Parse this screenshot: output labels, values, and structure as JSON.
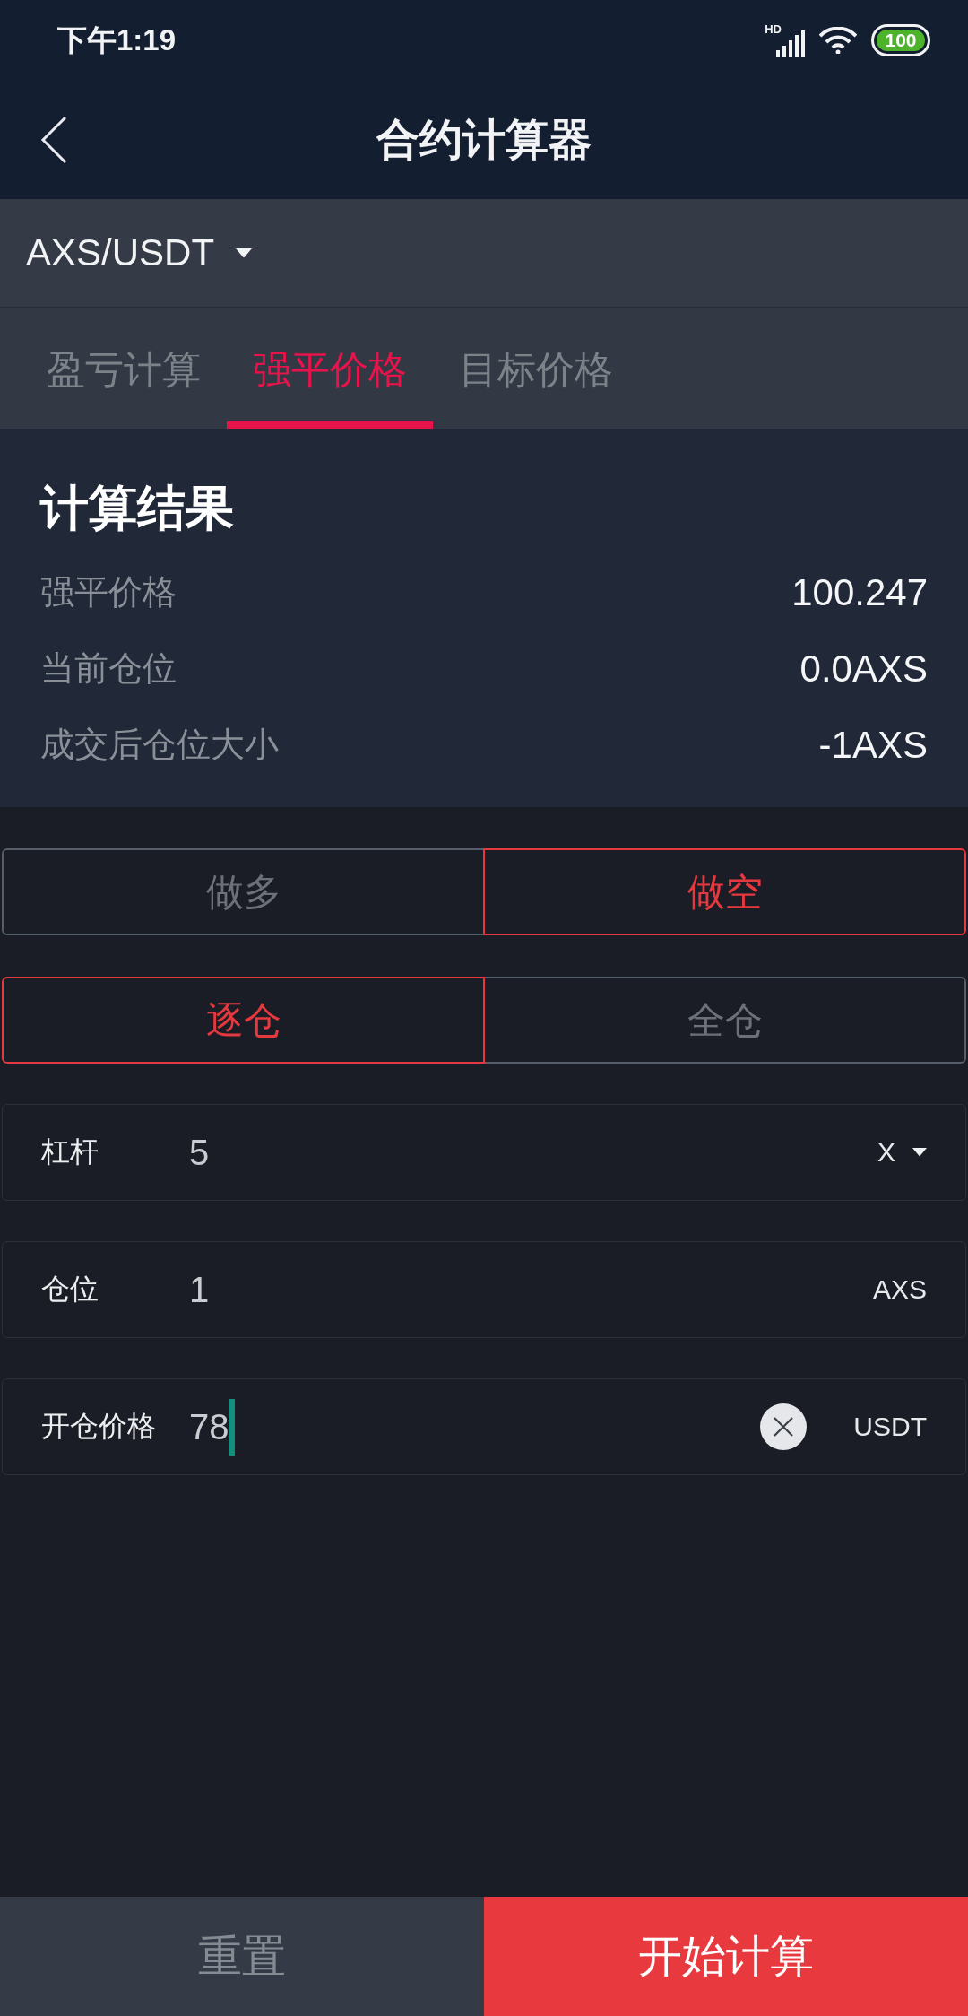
{
  "status_bar": {
    "time": "下午1:19",
    "network_type": "HD",
    "battery": "100"
  },
  "header": {
    "title": "合约计算器"
  },
  "pair_selector": {
    "value": "AXS/USDT"
  },
  "tabs": [
    {
      "label": "盈亏计算",
      "selected": false
    },
    {
      "label": "强平价格",
      "selected": true
    },
    {
      "label": "目标价格",
      "selected": false
    }
  ],
  "result": {
    "title": "计算结果",
    "rows": [
      {
        "label": "强平价格",
        "value": "100.247"
      },
      {
        "label": "当前仓位",
        "value": "0.0AXS"
      },
      {
        "label": "成交后仓位大小",
        "value": "-1AXS"
      }
    ]
  },
  "side_options": [
    {
      "label": "做多",
      "selected": false
    },
    {
      "label": "做空",
      "selected": true
    }
  ],
  "margin_options": [
    {
      "label": "逐仓",
      "selected": true
    },
    {
      "label": "全仓",
      "selected": false
    }
  ],
  "fields": [
    {
      "kind": "select",
      "label": "杠杆",
      "value": "5",
      "unit": "X",
      "focused": false
    },
    {
      "kind": "plain",
      "label": "仓位",
      "value": "1",
      "unit": "AXS",
      "focused": false
    },
    {
      "kind": "clearable",
      "label": "开仓价格",
      "value": "78",
      "unit": "USDT",
      "focused": true
    }
  ],
  "buttons": [
    {
      "kind": "secondary",
      "label": "重置"
    },
    {
      "kind": "primary",
      "label": "开始计算"
    }
  ]
}
